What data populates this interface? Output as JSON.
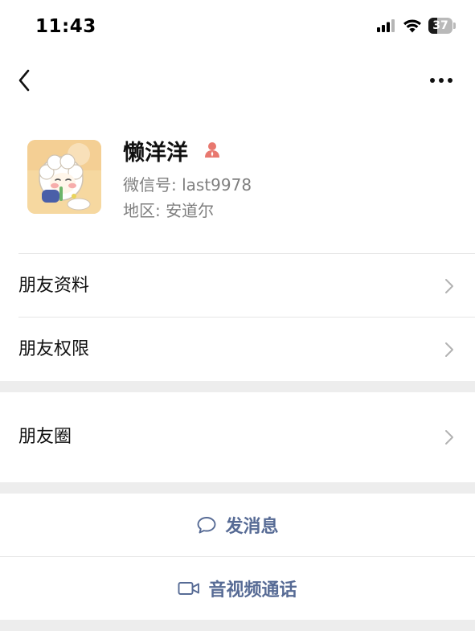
{
  "status_bar": {
    "time": "11:43",
    "battery_level": "37",
    "battery_percent": 37,
    "icons": [
      "cellular-signal-icon",
      "wifi-icon",
      "battery-icon"
    ]
  },
  "nav": {
    "back_icon": "chevron-left-icon",
    "more_icon": "more-dots-icon"
  },
  "profile": {
    "name": "懒洋洋",
    "badge_icon": "friend-person-icon",
    "wechat_id": "微信号: last9978",
    "region": "地区: 安道尔"
  },
  "menu": {
    "friend_info": "朋友资料",
    "friend_permissions": "朋友权限",
    "moments": "朋友圈"
  },
  "actions": {
    "send_message": "发消息",
    "send_message_icon": "chat-bubble-icon",
    "video_call": "音视频通话",
    "video_call_icon": "video-camera-icon"
  },
  "colors": {
    "link_blue": "#576b95",
    "badge_red": "#e8786f",
    "background": "#ededed"
  }
}
